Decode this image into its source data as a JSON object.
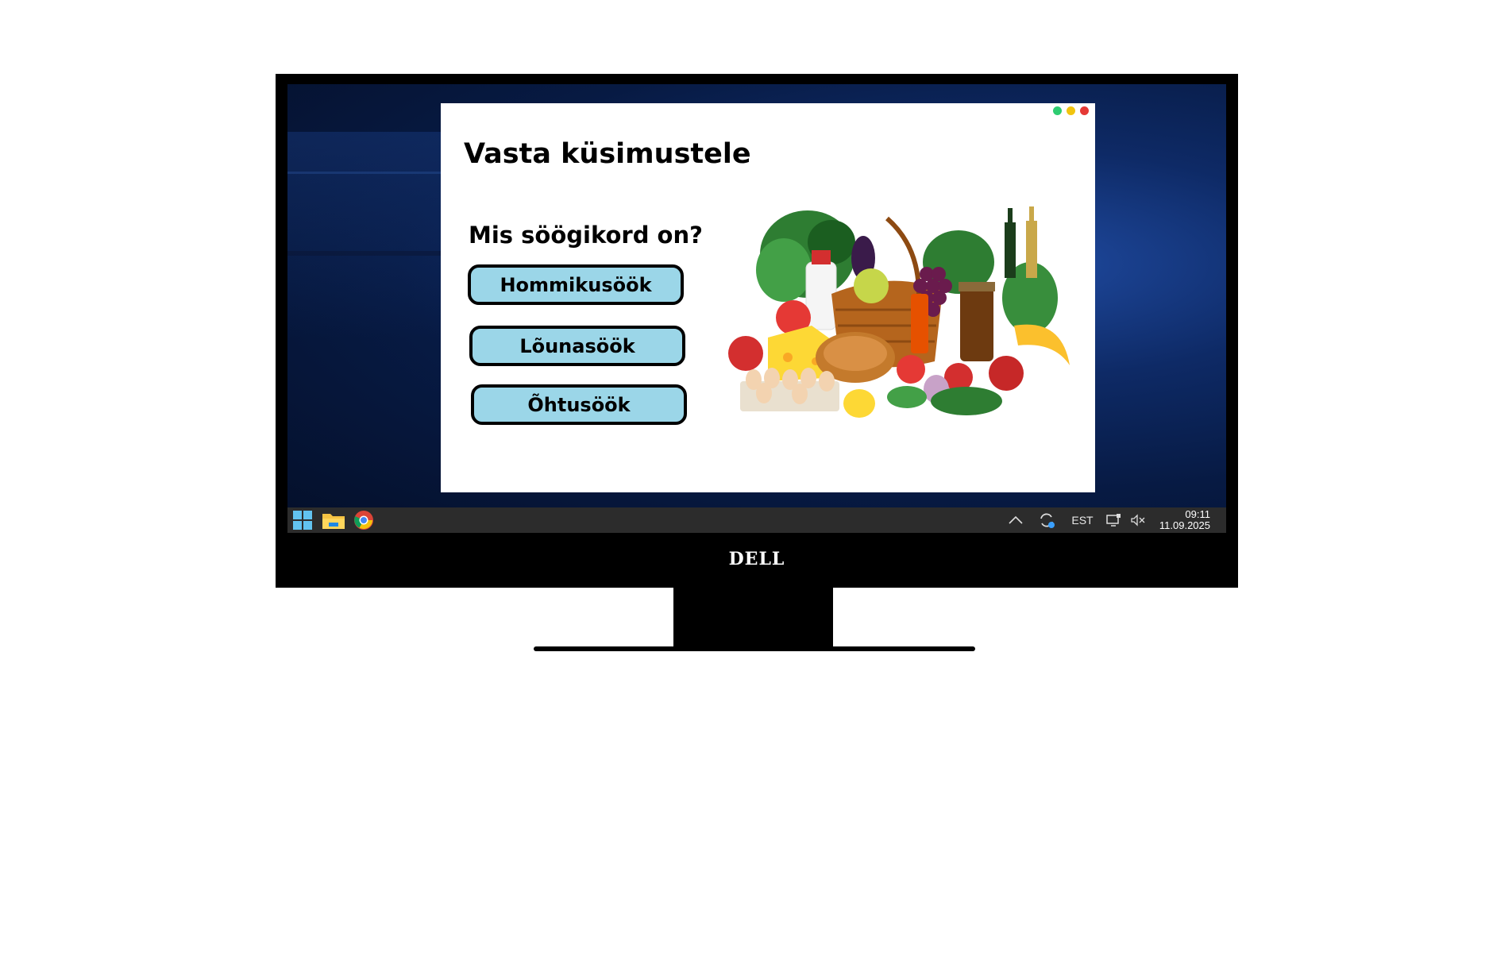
{
  "app": {
    "title": "Vasta küsimustele",
    "question": "Mis söögikord on?",
    "answers": [
      "Hommikusöök",
      "Lõunasöök",
      "Õhtusöök"
    ],
    "window_dots": [
      "#2ecc71",
      "#f1c40f",
      "#e53935"
    ],
    "image_alt": "grocery-basket-with-vegetables-fruits-bread-eggs"
  },
  "taskbar": {
    "start_icon": "windows-logo-icon",
    "pinned": [
      "file-explorer-icon",
      "chrome-icon"
    ],
    "tray": {
      "chevron_icon": "chevron-up-icon",
      "sync_icon": "sync-icon",
      "language": "EST",
      "display_icon": "display-icon",
      "volume_icon": "volume-muted-icon"
    },
    "clock": {
      "time": "09:11",
      "date": "11.09.2025"
    }
  },
  "monitor": {
    "brand": "DELL"
  },
  "colors": {
    "button_fill": "#9bd6e8",
    "taskbar": "#2c2c2c",
    "desktop": "#0a2256"
  }
}
